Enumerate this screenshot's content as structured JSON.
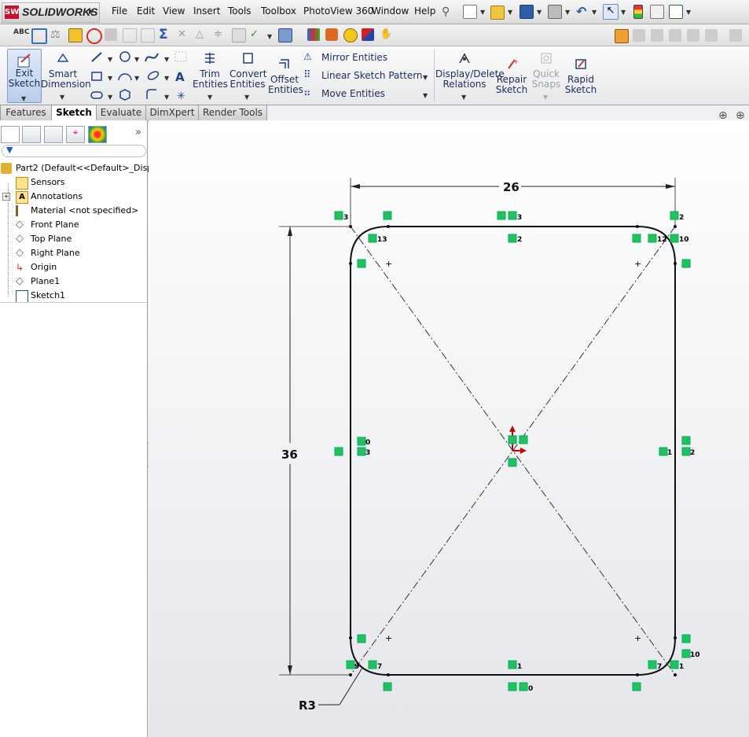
{
  "app": {
    "name": "SOLIDWORKS"
  },
  "menu": [
    "File",
    "Edit",
    "View",
    "Insert",
    "Tools",
    "Toolbox",
    "PhotoView 360",
    "Window",
    "Help"
  ],
  "command_manager": {
    "exit_sketch": "Exit Sketch",
    "smart_dimension": "Smart Dimension",
    "trim_entities": "Trim Entities",
    "convert_entities": "Convert Entities",
    "offset_entities": "Offset Entities",
    "mirror_entities": "Mirror Entities",
    "linear_sketch_pattern": "Linear Sketch Pattern",
    "move_entities": "Move Entities",
    "display_delete_relations": "Display/Delete Relations",
    "repair_sketch": "Repair Sketch",
    "quick_snaps": "Quick Snaps",
    "rapid_sketch": "Rapid Sketch"
  },
  "tabs": [
    {
      "label": "Features",
      "active": false
    },
    {
      "label": "Sketch",
      "active": true
    },
    {
      "label": "Evaluate",
      "active": false
    },
    {
      "label": "DimXpert",
      "active": false
    },
    {
      "label": "Render Tools",
      "active": false
    }
  ],
  "feature_tree": {
    "root": "Part2  (Default<<Default>_Displa",
    "items": [
      "Sensors",
      "Annotations",
      "Material <not specified>",
      "Front Plane",
      "Top Plane",
      "Right Plane",
      "Origin",
      "Plane1",
      "Sketch1"
    ]
  },
  "sketch": {
    "dim_width": "26",
    "dim_height": "36",
    "fillet_radius": "R3",
    "relation_labels": [
      "3",
      "3",
      "2",
      "13",
      "2",
      "12",
      "10",
      "0",
      "3",
      "1",
      "2",
      "7",
      "1",
      "0",
      "10",
      "9",
      "7",
      "1",
      "1"
    ]
  }
}
